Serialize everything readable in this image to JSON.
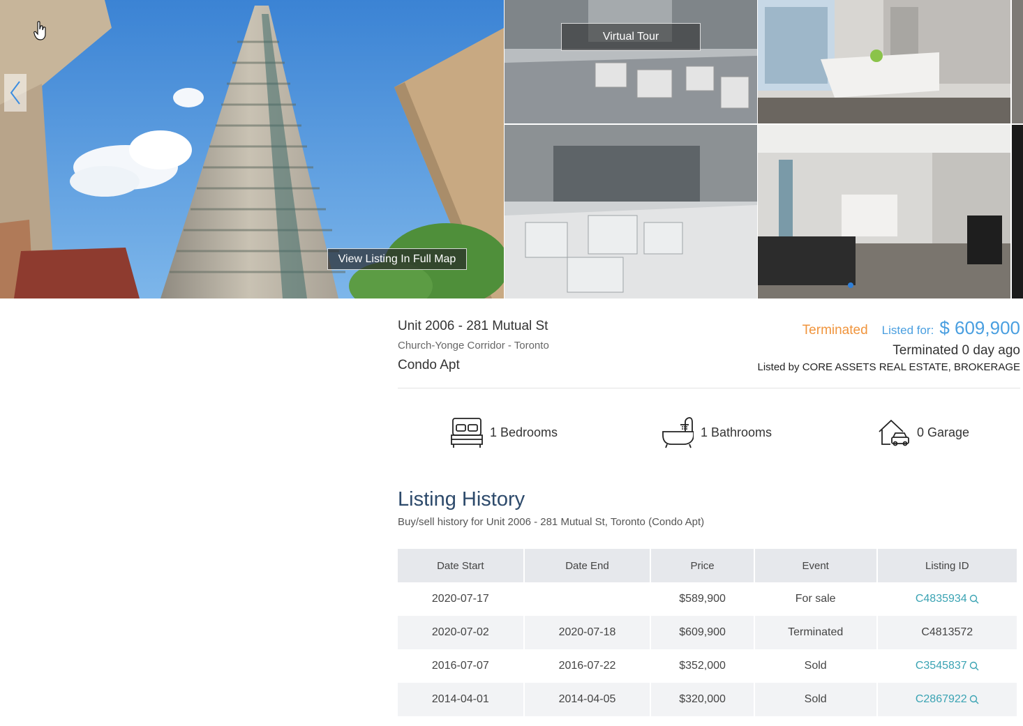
{
  "gallery": {
    "virtual_tour_label": "Virtual Tour",
    "full_map_label": "View Listing In Full Map",
    "dots_count": 1
  },
  "listing": {
    "address": "Unit 2006 - 281 Mutual St",
    "neighborhood": "Church-Yonge Corridor - Toronto",
    "property_type": "Condo Apt",
    "status": "Terminated",
    "listed_for_label": "Listed for:",
    "price": "$ 609,900",
    "terminated_ago": "Terminated 0 day ago",
    "listed_by": "Listed by CORE ASSETS REAL ESTATE, BROKERAGE"
  },
  "features": {
    "bedrooms": "1 Bedrooms",
    "bathrooms": "1 Bathrooms",
    "garage": "0 Garage"
  },
  "history": {
    "title": "Listing History",
    "subtitle": "Buy/sell history for Unit 2006 - 281 Mutual St, Toronto (Condo Apt)",
    "headers": [
      "Date Start",
      "Date End",
      "Price",
      "Event",
      "Listing ID"
    ],
    "rows": [
      {
        "start": "2020-07-17",
        "end": "",
        "price": "$589,900",
        "event": "For sale",
        "id": "C4835934"
      },
      {
        "start": "2020-07-02",
        "end": "2020-07-18",
        "price": "$609,900",
        "event": "Terminated",
        "id": "C4813572"
      },
      {
        "start": "2016-07-07",
        "end": "2016-07-22",
        "price": "$352,000",
        "event": "Sold",
        "id": "C3545837"
      },
      {
        "start": "2014-04-01",
        "end": "2014-04-05",
        "price": "$320,000",
        "event": "Sold",
        "id": "C2867922"
      }
    ]
  },
  "colors": {
    "status": "#f0943c",
    "price": "#4a9fe0",
    "link": "#3aa3b3",
    "title": "#2d4a6b"
  }
}
